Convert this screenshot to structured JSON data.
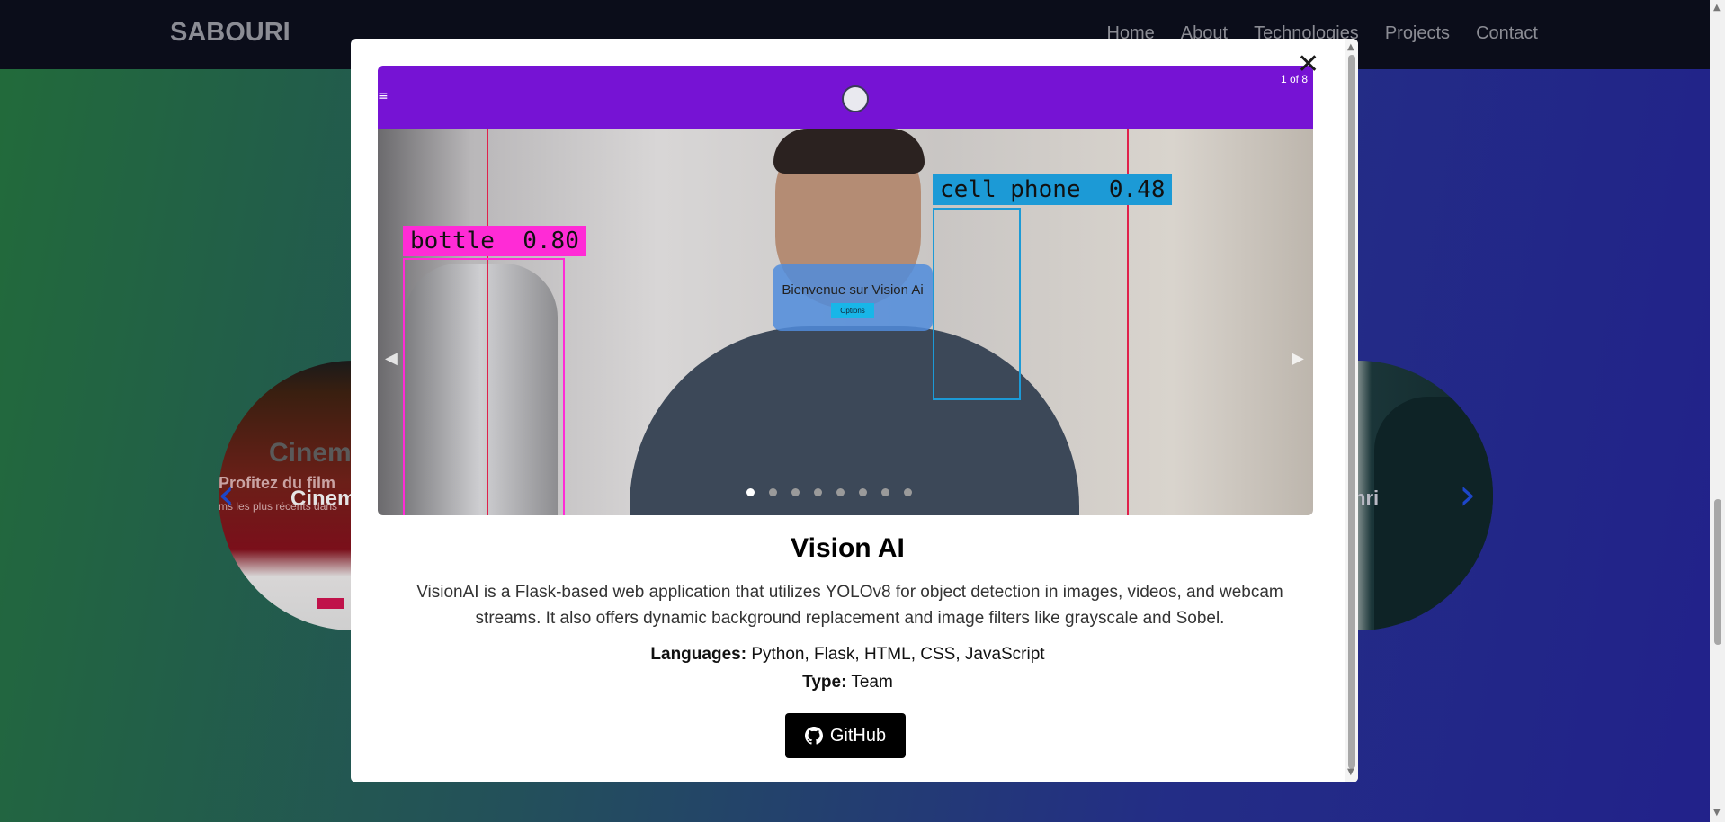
{
  "navbar": {
    "brand": "SABOURI",
    "links": [
      "Home",
      "About",
      "Technologies",
      "Projects",
      "Contact"
    ]
  },
  "background_carousel": {
    "left_card": {
      "title": "Cinem",
      "subtitle": "Profitez du film",
      "label": "Cinem",
      "tagline": "ms les plus récents dans"
    },
    "right_card": {
      "label": "hri"
    }
  },
  "modal": {
    "close_icon": "close-icon",
    "gallery": {
      "counter": "1 of 8",
      "detections": [
        {
          "label": "bottle",
          "score": "0.80",
          "color": "#ff2bd6"
        },
        {
          "label": "cell phone",
          "score": "0.48",
          "color": "#1c9ad6"
        }
      ],
      "overlay": {
        "title": "Bienvenue sur Vision Ai",
        "button": "Options"
      },
      "slide_count": 8,
      "active_slide": 1
    },
    "project": {
      "title": "Vision AI",
      "description": "VisionAI is a Flask-based web application that utilizes YOLOv8 for object detection in images, videos, and webcam streams. It also offers dynamic background replacement and image filters like grayscale and Sobel.",
      "languages_label": "Languages:",
      "languages": "Python, Flask, HTML, CSS, JavaScript",
      "type_label": "Type:",
      "type": "Team",
      "github_label": "GitHub"
    }
  },
  "colors": {
    "navbar_bg": "#0b0d1a",
    "gallery_header": "#7613d4",
    "button_bg": "#000000"
  }
}
